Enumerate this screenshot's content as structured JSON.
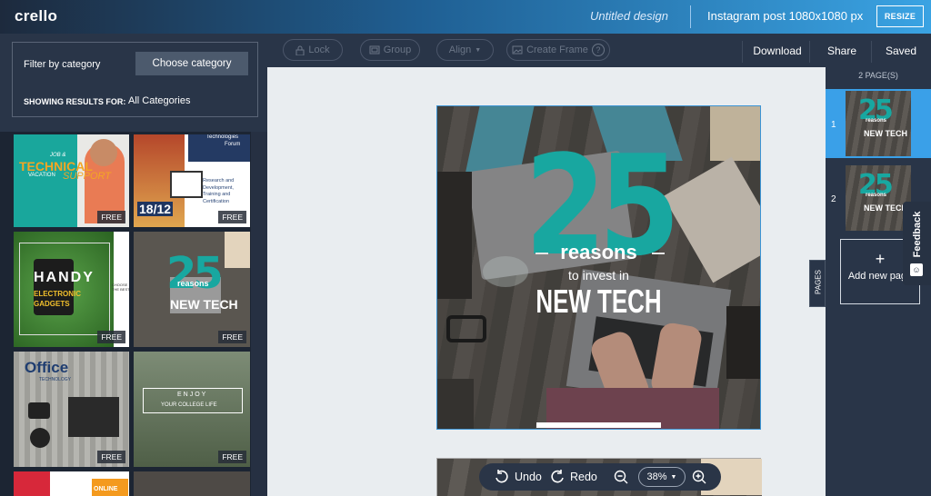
{
  "topbar": {
    "logo": "crello",
    "design_title": "Untitled design",
    "size_label": "Instagram post 1080x1080 px",
    "resize_label": "RESIZE"
  },
  "toolbar": {
    "lock": "Lock",
    "group": "Group",
    "align": "Align",
    "create_frame": "Create Frame",
    "download": "Download",
    "share": "Share",
    "saved": "Saved"
  },
  "left": {
    "filter_label": "Filter by category",
    "choose_label": "Choose category",
    "showing_label": "SHOWING RESULTS FOR:",
    "showing_value": "All Categories",
    "free_label": "FREE",
    "tiles": {
      "t1a": "JOB &",
      "t1b": "TECHNICAL",
      "t1c": "VACATION",
      "t1d": "SUPPORT",
      "t2a": "Technologies",
      "t2b": "Forum",
      "t2c": "Research and Development, Training and Certification",
      "t2d": "18/12",
      "t3a": "HANDY",
      "t3b": "ELECTRONIC",
      "t3c": "GADGETS",
      "t3d": "CHOOSE THE BEST",
      "t5a": "Office",
      "t5b": "TECHNOLOGY",
      "t6a": "ENJOY",
      "t6b": "YOUR COLLEGE LIFE",
      "t7a": "ONLINE"
    }
  },
  "design": {
    "big_number": "25",
    "line1": "reasons",
    "line2": "to invest in",
    "line3": "NEW TECH"
  },
  "bottombar": {
    "undo": "Undo",
    "redo": "Redo",
    "zoom": "38%"
  },
  "pages": {
    "count_label": "2 PAGE(S)",
    "items": [
      {
        "num": "1"
      },
      {
        "num": "2"
      }
    ],
    "add_page": "Add new page",
    "tab_label": "PAGES"
  },
  "feedback_label": "Feedback",
  "colors": {
    "accent_teal": "#18a7a0",
    "selection_blue": "#3c94d4",
    "panel_dark": "#293548"
  }
}
